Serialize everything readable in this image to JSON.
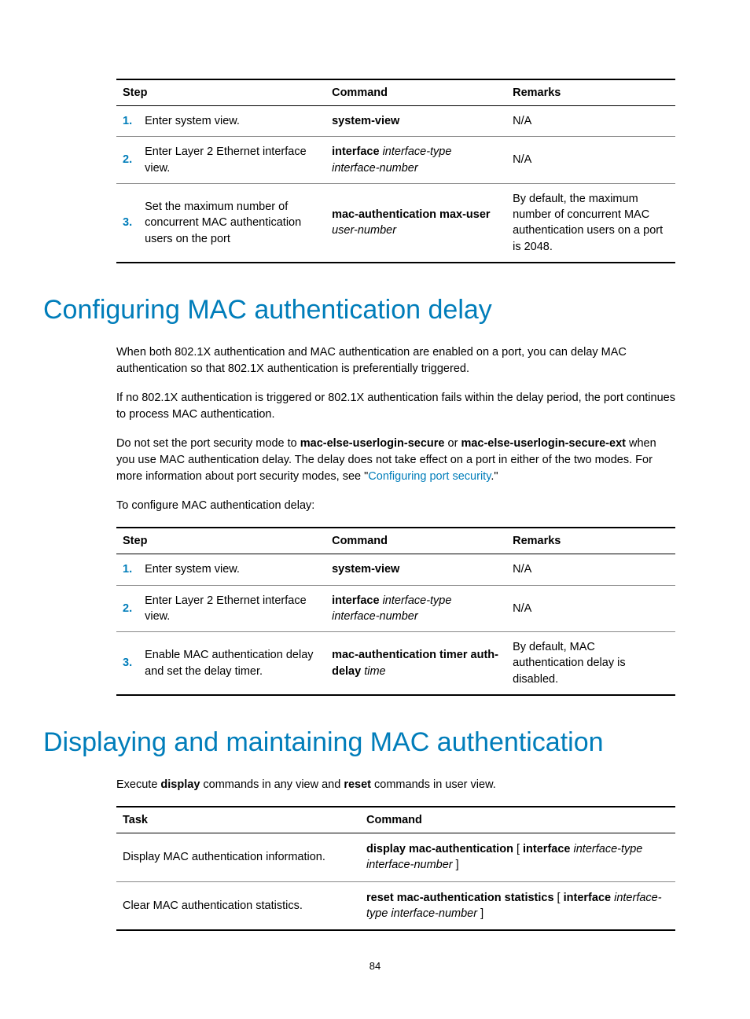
{
  "table1": {
    "headers": {
      "step": "Step",
      "command": "Command",
      "remarks": "Remarks"
    },
    "rows": [
      {
        "num": "1.",
        "step": "Enter system view.",
        "cmd_bold": "system-view",
        "remarks": "N/A"
      },
      {
        "num": "2.",
        "step": "Enter Layer 2 Ethernet interface view.",
        "cmd_bold": "interface ",
        "cmd_ital1": "interface-type interface-number",
        "remarks": "N/A"
      },
      {
        "num": "3.",
        "step": "Set the maximum number of concurrent MAC authentication users on the port",
        "cmd_bold": "mac-authentication max-user ",
        "cmd_ital1": "user-number",
        "remarks": "By default, the maximum number of concurrent MAC authentication users on a port is 2048."
      }
    ]
  },
  "heading1": "Configuring MAC authentication delay",
  "para1": "When both 802.1X authentication and MAC authentication are enabled on a port, you can delay MAC authentication so that 802.1X authentication is preferentially triggered.",
  "para2": "If no 802.1X authentication is triggered or 802.1X authentication fails within the delay period, the port continues to process MAC authentication.",
  "para3_pre": "Do not set the port security mode to ",
  "para3_b1": "mac-else-userlogin-secure",
  "para3_mid1": " or ",
  "para3_b2": "mac-else-userlogin-secure-ext",
  "para3_mid2": " when you use MAC authentication delay. The delay does not take effect on a port in either of the two modes. For more information about port security modes, see \"",
  "para3_link": "Configuring port security",
  "para3_post": ".\"",
  "para4": "To configure MAC authentication delay:",
  "table2": {
    "headers": {
      "step": "Step",
      "command": "Command",
      "remarks": "Remarks"
    },
    "rows": [
      {
        "num": "1.",
        "step": "Enter system view.",
        "cmd_bold": "system-view",
        "remarks": "N/A"
      },
      {
        "num": "2.",
        "step": "Enter Layer 2 Ethernet interface view.",
        "cmd_bold": "interface ",
        "cmd_ital1": "interface-type interface-number",
        "remarks": "N/A"
      },
      {
        "num": "3.",
        "step": "Enable MAC authentication delay and set the delay timer.",
        "cmd_bold": "mac-authentication timer auth-delay ",
        "cmd_ital1": "time",
        "remarks": "By default, MAC authentication delay is disabled."
      }
    ]
  },
  "heading2": "Displaying and maintaining MAC authentication",
  "para5_pre": "Execute ",
  "para5_b1": "display",
  "para5_mid": " commands in any view and ",
  "para5_b2": "reset",
  "para5_post": " commands in user view.",
  "table3": {
    "headers": {
      "task": "Task",
      "command": "Command"
    },
    "rows": [
      {
        "task": "Display MAC authentication information.",
        "cmd_b1": "display mac-authentication",
        "cmd_t1": " [ ",
        "cmd_b2": "interface",
        "cmd_t2": " ",
        "cmd_i1": "interface-type interface-number",
        "cmd_t3": " ]"
      },
      {
        "task": "Clear MAC authentication statistics.",
        "cmd_b1": "reset mac-authentication statistics",
        "cmd_t1": " [ ",
        "cmd_b2": "interface",
        "cmd_t2": " ",
        "cmd_i1": "interface-type interface-number",
        "cmd_t3": " ]"
      }
    ]
  },
  "page_number": "84"
}
